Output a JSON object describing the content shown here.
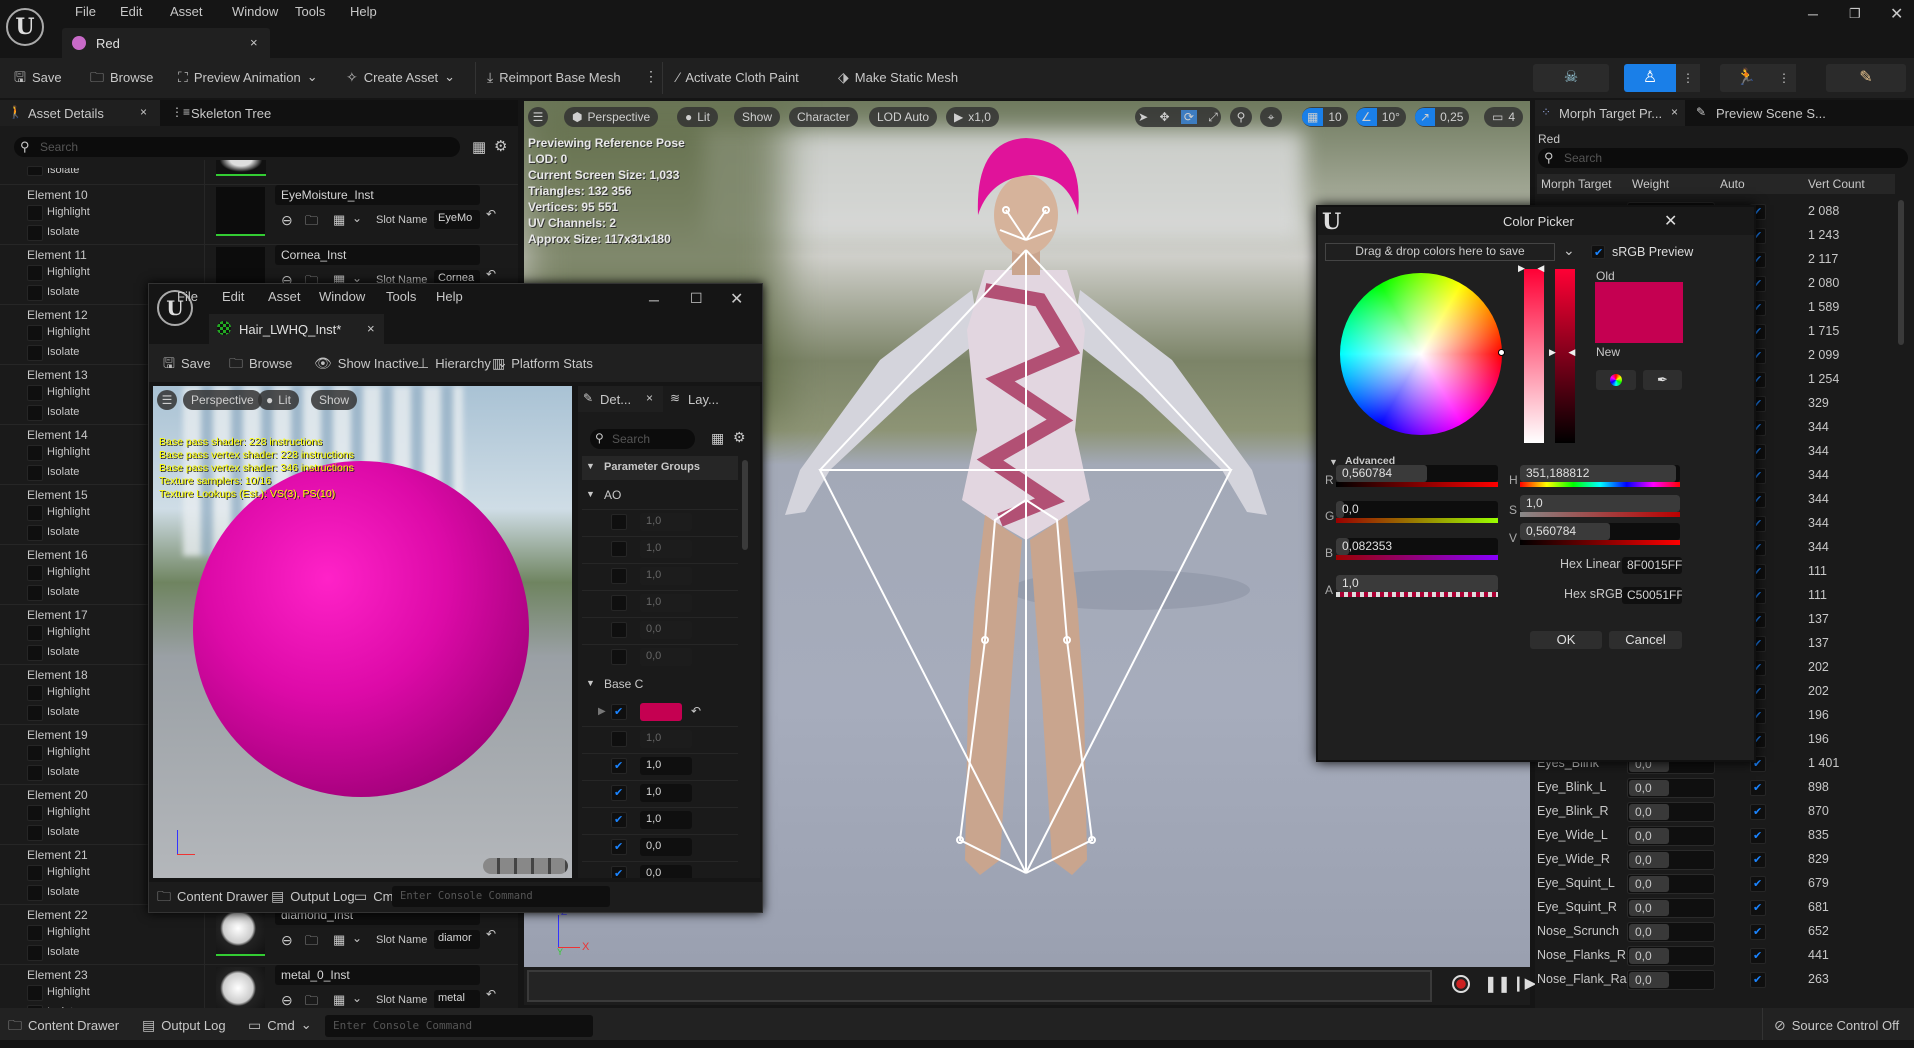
{
  "app": {
    "menus": [
      "File",
      "Edit",
      "Asset",
      "Window",
      "Tools",
      "Help"
    ],
    "tab": "Red",
    "toolbar": {
      "save": "Save",
      "browse": "Browse",
      "preview_animation": "Preview Animation",
      "create_asset": "Create Asset",
      "reimport": "Reimport Base Mesh",
      "activate_cloth_paint": "Activate Cloth Paint",
      "make_static_mesh": "Make Static Mesh"
    }
  },
  "left_panel": {
    "tabs": [
      "Asset Details",
      "Skeleton Tree"
    ],
    "search_placeholder": "Search",
    "top_partial": "Isolate",
    "highlight": "Highlight",
    "isolate": "Isolate",
    "slot_label": "Slot Name",
    "elements": [
      "Element 10",
      "Element 11",
      "Element 12",
      "Element 13",
      "Element 14",
      "Element 15",
      "Element 16",
      "Element 17",
      "Element 18",
      "Element 19",
      "Element 20",
      "Element 21",
      "Element 22",
      "Element 23"
    ],
    "materials": [
      {
        "element_index": 0,
        "name": "EyeMoisture_Inst",
        "slot": "EyeMo"
      },
      {
        "element_index": 1,
        "name": "Cornea_Inst",
        "slot": "Cornea"
      },
      {
        "element_index": 12,
        "name": "diamond_Inst",
        "slot": "diamor"
      },
      {
        "element_index": 13,
        "name": "metal_0_Inst",
        "slot": "metal"
      }
    ]
  },
  "viewport": {
    "buttons": {
      "perspective": "Perspective",
      "lit": "Lit",
      "show": "Show",
      "character": "Character",
      "lod": "LOD Auto",
      "speed": "x1,0"
    },
    "snap": {
      "grid": "10",
      "angle": "10°",
      "scale": "0,25",
      "camera": "4"
    },
    "stats": [
      "Previewing Reference Pose",
      "LOD: 0",
      "Current Screen Size: 1,033",
      "Triangles: 132 356",
      "Vertices: 95 551",
      "UV Channels: 2",
      "Approx Size: 117x31x180"
    ],
    "axis": {
      "x": "X",
      "y": "Y",
      "z": "Z"
    }
  },
  "material_editor": {
    "menus": [
      "File",
      "Edit",
      "Asset",
      "Window",
      "Tools",
      "Help"
    ],
    "tab": "Hair_LWHQ_Inst*",
    "toolbar": {
      "save": "Save",
      "browse": "Browse",
      "show_inactive": "Show Inactive",
      "hierarchy": "Hierarchy",
      "platform_stats": "Platform Stats"
    },
    "viewport_buttons": {
      "perspective": "Perspective",
      "lit": "Lit",
      "show": "Show"
    },
    "stats": [
      "Base pass shader: 228 instructions",
      "Base pass vertex shader: 228 instructions",
      "Base pass vertex shader: 346 instructions",
      "Texture samplers: 10/16",
      "Texture Lookups (Est.): VS(3), PS(10)"
    ],
    "details_tabs": [
      "Det...",
      "Lay..."
    ],
    "search_placeholder": "Search",
    "groups_label": "Parameter Groups",
    "ao_label": "AO",
    "ao_rows": [
      {
        "checked": false,
        "value": "1,0"
      },
      {
        "checked": false,
        "value": "1,0"
      },
      {
        "checked": false,
        "value": "1,0"
      },
      {
        "checked": false,
        "value": "1,0"
      },
      {
        "checked": false,
        "value": "0,0"
      },
      {
        "checked": false,
        "value": "0,0"
      }
    ],
    "base_label": "Base C",
    "base_color": "#C50051",
    "base_rows": [
      {
        "checked": false,
        "value": "1,0"
      },
      {
        "checked": true,
        "value": "1,0"
      },
      {
        "checked": true,
        "value": "1,0"
      },
      {
        "checked": true,
        "value": "1,0"
      },
      {
        "checked": true,
        "value": "0,0"
      },
      {
        "checked": true,
        "value": "0,0"
      }
    ],
    "bottom": {
      "content_drawer": "Content Drawer",
      "output_log": "Output Log",
      "cmd": "Cmd",
      "console_placeholder": "Enter Console Command"
    }
  },
  "color_picker": {
    "title": "Color Picker",
    "drop_label": "Drag & drop colors here to save",
    "srgb_label": "sRGB Preview",
    "srgb_checked": true,
    "old_label": "Old",
    "new_label": "New",
    "advanced_label": "Advanced",
    "old_color": "#C50051",
    "r": {
      "label": "R",
      "value": "0,560784",
      "fraction": 0.560784
    },
    "g": {
      "label": "G",
      "value": "0,0",
      "fraction": 0
    },
    "b": {
      "label": "B",
      "value": "0,082353",
      "fraction": 0.082353
    },
    "a": {
      "label": "A",
      "value": "1,0",
      "fraction": 1
    },
    "h": {
      "label": "H",
      "value": "351,188812",
      "fraction": 0.9755
    },
    "s": {
      "label": "S",
      "value": "1,0",
      "fraction": 1
    },
    "v": {
      "label": "V",
      "value": "0,560784",
      "fraction": 0.560784
    },
    "hex_linear_label": "Hex Linear",
    "hex_linear": "8F0015FF",
    "hex_srgb_label": "Hex sRGB",
    "hex_srgb": "C50051FF",
    "ok": "OK",
    "cancel": "Cancel"
  },
  "morph_panel": {
    "tabs": [
      "Morph Target Pr...",
      "Preview Scene S..."
    ],
    "asset": "Red",
    "search_placeholder": "Search",
    "columns": [
      "Morph Target",
      "Weight",
      "Auto",
      "Vert Count"
    ],
    "rows": [
      {
        "name": "",
        "weight": "",
        "auto": true,
        "count": "2 088"
      },
      {
        "name": "",
        "weight": "",
        "auto": true,
        "count": "1 243"
      },
      {
        "name": "",
        "weight": "",
        "auto": true,
        "count": "2 117"
      },
      {
        "name": "",
        "weight": "",
        "auto": true,
        "count": "2 080"
      },
      {
        "name": "",
        "weight": "",
        "auto": true,
        "count": "1 589"
      },
      {
        "name": "",
        "weight": "",
        "auto": true,
        "count": "1 715"
      },
      {
        "name": "",
        "weight": "",
        "auto": true,
        "count": "2 099"
      },
      {
        "name": "",
        "weight": "",
        "auto": true,
        "count": "1 254"
      },
      {
        "name": "",
        "weight": "",
        "auto": true,
        "count": "329"
      },
      {
        "name": "",
        "weight": "",
        "auto": true,
        "count": "344"
      },
      {
        "name": "",
        "weight": "",
        "auto": true,
        "count": "344"
      },
      {
        "name": "",
        "weight": "",
        "auto": true,
        "count": "344"
      },
      {
        "name": "",
        "weight": "",
        "auto": true,
        "count": "344"
      },
      {
        "name": "",
        "weight": "",
        "auto": true,
        "count": "344"
      },
      {
        "name": "",
        "weight": "",
        "auto": true,
        "count": "344"
      },
      {
        "name": "",
        "weight": "",
        "auto": true,
        "count": "111"
      },
      {
        "name": "",
        "weight": "",
        "auto": true,
        "count": "111"
      },
      {
        "name": "",
        "weight": "",
        "auto": true,
        "count": "137"
      },
      {
        "name": "",
        "weight": "",
        "auto": true,
        "count": "137"
      },
      {
        "name": "",
        "weight": "",
        "auto": true,
        "count": "202"
      },
      {
        "name": "",
        "weight": "",
        "auto": true,
        "count": "202"
      },
      {
        "name": "",
        "weight": "",
        "auto": true,
        "count": "196"
      },
      {
        "name": "",
        "weight": "",
        "auto": true,
        "count": "196"
      },
      {
        "name": "Eyes_Blink",
        "weight": "0,0",
        "auto": true,
        "count": "1 401"
      },
      {
        "name": "Eye_Blink_L",
        "weight": "0,0",
        "auto": true,
        "count": "898"
      },
      {
        "name": "Eye_Blink_R",
        "weight": "0,0",
        "auto": true,
        "count": "870"
      },
      {
        "name": "Eye_Wide_L",
        "weight": "0,0",
        "auto": true,
        "count": "835"
      },
      {
        "name": "Eye_Wide_R",
        "weight": "0,0",
        "auto": true,
        "count": "829"
      },
      {
        "name": "Eye_Squint_L",
        "weight": "0,0",
        "auto": true,
        "count": "679"
      },
      {
        "name": "Eye_Squint_R",
        "weight": "0,0",
        "auto": true,
        "count": "681"
      },
      {
        "name": "Nose_Scrunch",
        "weight": "0,0",
        "auto": true,
        "count": "652"
      },
      {
        "name": "Nose_Flanks_R",
        "weight": "0,0",
        "auto": true,
        "count": "441"
      },
      {
        "name": "Nose_Flank_Ra",
        "weight": "0,0",
        "auto": true,
        "count": "263"
      }
    ]
  },
  "status_bar": {
    "content_drawer": "Content Drawer",
    "output_log": "Output Log",
    "cmd": "Cmd",
    "console_placeholder": "Enter Console Command",
    "source_control": "Source Control Off"
  }
}
